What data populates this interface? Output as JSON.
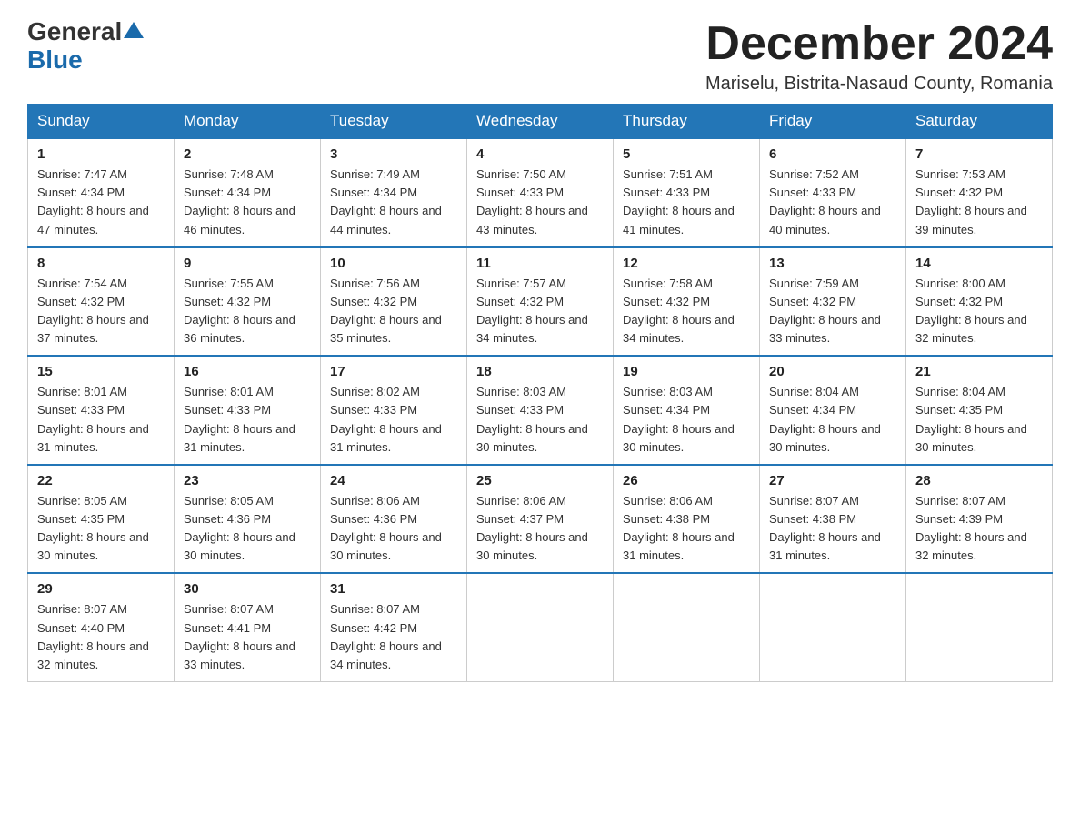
{
  "header": {
    "logo_general": "General",
    "logo_blue": "Blue",
    "month_title": "December 2024",
    "location": "Mariselu, Bistrita-Nasaud County, Romania"
  },
  "weekdays": [
    "Sunday",
    "Monday",
    "Tuesday",
    "Wednesday",
    "Thursday",
    "Friday",
    "Saturday"
  ],
  "weeks": [
    [
      {
        "day": "1",
        "sunrise": "7:47 AM",
        "sunset": "4:34 PM",
        "daylight": "8 hours and 47 minutes."
      },
      {
        "day": "2",
        "sunrise": "7:48 AM",
        "sunset": "4:34 PM",
        "daylight": "8 hours and 46 minutes."
      },
      {
        "day": "3",
        "sunrise": "7:49 AM",
        "sunset": "4:34 PM",
        "daylight": "8 hours and 44 minutes."
      },
      {
        "day": "4",
        "sunrise": "7:50 AM",
        "sunset": "4:33 PM",
        "daylight": "8 hours and 43 minutes."
      },
      {
        "day": "5",
        "sunrise": "7:51 AM",
        "sunset": "4:33 PM",
        "daylight": "8 hours and 41 minutes."
      },
      {
        "day": "6",
        "sunrise": "7:52 AM",
        "sunset": "4:33 PM",
        "daylight": "8 hours and 40 minutes."
      },
      {
        "day": "7",
        "sunrise": "7:53 AM",
        "sunset": "4:32 PM",
        "daylight": "8 hours and 39 minutes."
      }
    ],
    [
      {
        "day": "8",
        "sunrise": "7:54 AM",
        "sunset": "4:32 PM",
        "daylight": "8 hours and 37 minutes."
      },
      {
        "day": "9",
        "sunrise": "7:55 AM",
        "sunset": "4:32 PM",
        "daylight": "8 hours and 36 minutes."
      },
      {
        "day": "10",
        "sunrise": "7:56 AM",
        "sunset": "4:32 PM",
        "daylight": "8 hours and 35 minutes."
      },
      {
        "day": "11",
        "sunrise": "7:57 AM",
        "sunset": "4:32 PM",
        "daylight": "8 hours and 34 minutes."
      },
      {
        "day": "12",
        "sunrise": "7:58 AM",
        "sunset": "4:32 PM",
        "daylight": "8 hours and 34 minutes."
      },
      {
        "day": "13",
        "sunrise": "7:59 AM",
        "sunset": "4:32 PM",
        "daylight": "8 hours and 33 minutes."
      },
      {
        "day": "14",
        "sunrise": "8:00 AM",
        "sunset": "4:32 PM",
        "daylight": "8 hours and 32 minutes."
      }
    ],
    [
      {
        "day": "15",
        "sunrise": "8:01 AM",
        "sunset": "4:33 PM",
        "daylight": "8 hours and 31 minutes."
      },
      {
        "day": "16",
        "sunrise": "8:01 AM",
        "sunset": "4:33 PM",
        "daylight": "8 hours and 31 minutes."
      },
      {
        "day": "17",
        "sunrise": "8:02 AM",
        "sunset": "4:33 PM",
        "daylight": "8 hours and 31 minutes."
      },
      {
        "day": "18",
        "sunrise": "8:03 AM",
        "sunset": "4:33 PM",
        "daylight": "8 hours and 30 minutes."
      },
      {
        "day": "19",
        "sunrise": "8:03 AM",
        "sunset": "4:34 PM",
        "daylight": "8 hours and 30 minutes."
      },
      {
        "day": "20",
        "sunrise": "8:04 AM",
        "sunset": "4:34 PM",
        "daylight": "8 hours and 30 minutes."
      },
      {
        "day": "21",
        "sunrise": "8:04 AM",
        "sunset": "4:35 PM",
        "daylight": "8 hours and 30 minutes."
      }
    ],
    [
      {
        "day": "22",
        "sunrise": "8:05 AM",
        "sunset": "4:35 PM",
        "daylight": "8 hours and 30 minutes."
      },
      {
        "day": "23",
        "sunrise": "8:05 AM",
        "sunset": "4:36 PM",
        "daylight": "8 hours and 30 minutes."
      },
      {
        "day": "24",
        "sunrise": "8:06 AM",
        "sunset": "4:36 PM",
        "daylight": "8 hours and 30 minutes."
      },
      {
        "day": "25",
        "sunrise": "8:06 AM",
        "sunset": "4:37 PM",
        "daylight": "8 hours and 30 minutes."
      },
      {
        "day": "26",
        "sunrise": "8:06 AM",
        "sunset": "4:38 PM",
        "daylight": "8 hours and 31 minutes."
      },
      {
        "day": "27",
        "sunrise": "8:07 AM",
        "sunset": "4:38 PM",
        "daylight": "8 hours and 31 minutes."
      },
      {
        "day": "28",
        "sunrise": "8:07 AM",
        "sunset": "4:39 PM",
        "daylight": "8 hours and 32 minutes."
      }
    ],
    [
      {
        "day": "29",
        "sunrise": "8:07 AM",
        "sunset": "4:40 PM",
        "daylight": "8 hours and 32 minutes."
      },
      {
        "day": "30",
        "sunrise": "8:07 AM",
        "sunset": "4:41 PM",
        "daylight": "8 hours and 33 minutes."
      },
      {
        "day": "31",
        "sunrise": "8:07 AM",
        "sunset": "4:42 PM",
        "daylight": "8 hours and 34 minutes."
      },
      null,
      null,
      null,
      null
    ]
  ],
  "labels": {
    "sunrise": "Sunrise:",
    "sunset": "Sunset:",
    "daylight": "Daylight:"
  }
}
